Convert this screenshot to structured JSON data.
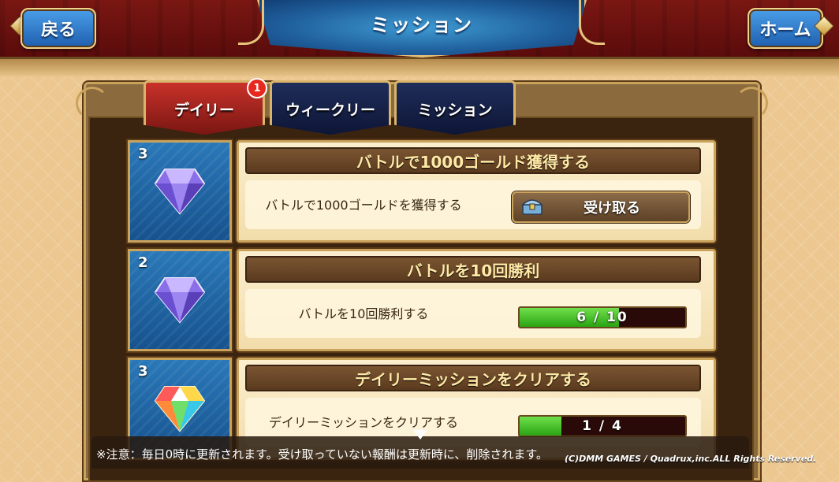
{
  "header": {
    "back_label": "戻る",
    "title": "ミッション",
    "home_label": "ホーム"
  },
  "tabs": [
    {
      "label": "デイリー",
      "badge": "1",
      "active": true
    },
    {
      "label": "ウィークリー",
      "active": false
    },
    {
      "label": "ミッション",
      "active": false
    }
  ],
  "missions": [
    {
      "reward_count": "3",
      "reward_icon": "purple-gem-icon",
      "title": "バトルで1000ゴールド獲得する",
      "description": "バトルで1000ゴールドを獲得する",
      "action_label": "受け取る",
      "action_icon": "treasure-chest-icon"
    },
    {
      "reward_count": "2",
      "reward_icon": "purple-gem-icon",
      "title": "バトルを10回勝利",
      "description": "バトルを10回勝利する",
      "progress_text": "6 / 10",
      "progress_fraction": 0.6
    },
    {
      "reward_count": "3",
      "reward_icon": "rainbow-gem-icon",
      "title": "デイリーミッションをクリアする",
      "description": "デイリーミッションをクリアする",
      "progress_text": "1 / 4",
      "progress_fraction": 0.25
    }
  ],
  "footer": {
    "notice": "※注意：毎日0時に更新されます。受け取っていない報酬は更新時に、削除されます。",
    "copyright": "(C)DMM GAMES / Quadrux,inc.ALL Rights Reserved."
  },
  "colors": {
    "accent_gold": "#c9a25c",
    "header_red": "#7a1713",
    "progress_green": "#2aa314"
  }
}
